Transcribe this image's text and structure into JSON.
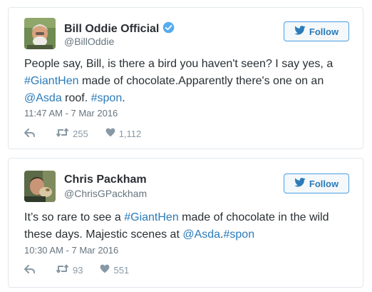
{
  "colors": {
    "link": "#2b7bb9",
    "text": "#292f33",
    "muted": "#66757f",
    "action": "#8899a6",
    "verified": "#55acee",
    "border": "#e1e8ed"
  },
  "follow_label": "Follow",
  "tweets": [
    {
      "name": "Bill Oddie Official",
      "verified": true,
      "handle": "@BillOddie",
      "segments": [
        {
          "text": "People say, Bill, is there a bird you haven't seen? I say yes, a ",
          "link": false
        },
        {
          "text": "#GiantHen",
          "link": true
        },
        {
          "text": " made of chocolate.Apparently there's one on an ",
          "link": false
        },
        {
          "text": "@Asda",
          "link": true
        },
        {
          "text": " roof. ",
          "link": false
        },
        {
          "text": "#spon",
          "link": true
        },
        {
          "text": ".",
          "link": false
        }
      ],
      "timestamp": "11:47 AM - 7 Mar 2016",
      "retweets": "255",
      "likes": "1,112",
      "icons": [
        "reply-icon",
        "retweet-icon",
        "heart-icon"
      ]
    },
    {
      "name": "Chris Packham",
      "verified": false,
      "handle": "@ChrisGPackham",
      "segments": [
        {
          "text": "It’s so rare to see a ",
          "link": false
        },
        {
          "text": "#GiantHen",
          "link": true
        },
        {
          "text": " made of chocolate in the wild these days. Majestic scenes at ",
          "link": false
        },
        {
          "text": "@Asda",
          "link": true
        },
        {
          "text": ".",
          "link": false
        },
        {
          "text": "#spon",
          "link": true
        }
      ],
      "timestamp": "10:30 AM - 7 Mar 2016",
      "retweets": "93",
      "likes": "551",
      "icons": [
        "reply-icon",
        "retweet-icon",
        "heart-icon"
      ]
    }
  ]
}
